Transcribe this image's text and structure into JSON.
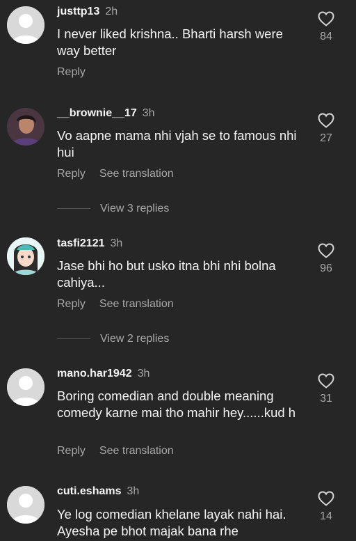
{
  "comments": [
    {
      "username": "justtp13",
      "time": "2h",
      "text": "I never liked krishna.. Bharti harsh were way better",
      "likes": "84",
      "reply": "Reply",
      "translate": ""
    },
    {
      "username": "__brownie__17",
      "time": "3h",
      "text": "Vo aapne mama nhi vjah se to famous nhi hui",
      "likes": "27",
      "reply": "Reply",
      "translate": "See translation"
    },
    {
      "username": "tasfi2121",
      "time": "3h",
      "text": "Jase bhi ho but usko itna bhi nhi bolna cahiya...",
      "likes": "96",
      "reply": "Reply",
      "translate": "See translation"
    },
    {
      "username": "mano.har1942",
      "time": "3h",
      "text": "Boring comedian and double meaning comedy karne mai tho mahir hey......kud h",
      "likes": "31",
      "reply": "Reply",
      "translate": "See translation"
    },
    {
      "username": "cuti.eshams",
      "time": "3h",
      "text": "Ye log comedian khelane layak nahi hai. Ayesha pe bhot majak bana rhe",
      "likes": "14",
      "reply": "",
      "translate": ""
    }
  ],
  "view_replies": [
    "View 3 replies",
    "View 2 replies"
  ],
  "icons": {
    "like": "heart-outline-icon",
    "avatar": "default-avatar-icon"
  }
}
